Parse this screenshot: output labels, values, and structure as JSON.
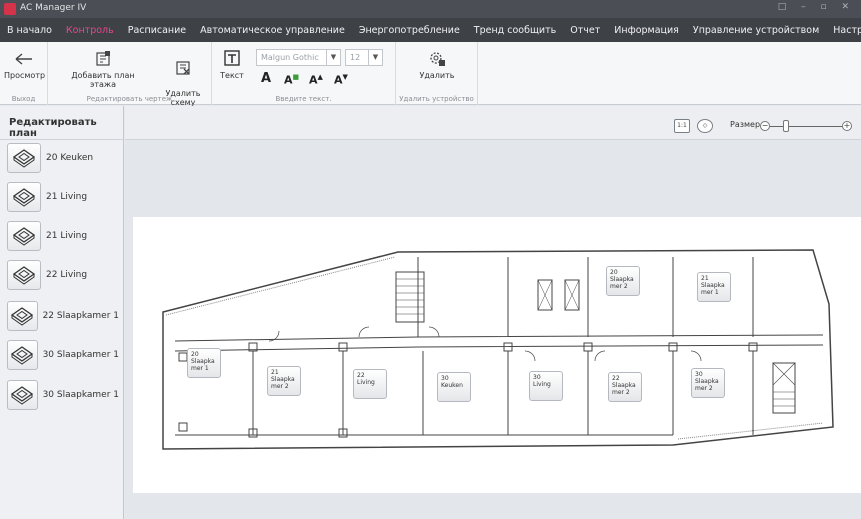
{
  "window": {
    "title": "AC Manager IV",
    "controls": "□ – ▫ ✕"
  },
  "menu": {
    "items": [
      {
        "label": "В начало",
        "active": false
      },
      {
        "label": "Контроль",
        "active": true
      },
      {
        "label": "Расписание",
        "active": false
      },
      {
        "label": "Автоматическое управление",
        "active": false
      },
      {
        "label": "Энергопотребление",
        "active": false
      },
      {
        "label": "Тренд сообщить",
        "active": false
      },
      {
        "label": "Отчет",
        "active": false
      },
      {
        "label": "Информация",
        "active": false
      },
      {
        "label": "Управление устройством",
        "active": false
      },
      {
        "label": "Настройки",
        "active": false
      }
    ]
  },
  "ribbon": {
    "exit_group": {
      "label": "Выход",
      "view_button": "Просмотр"
    },
    "edit_group": {
      "label": "Редактировать чертеж",
      "add_floor_button": "Добавить план этажа",
      "delete_plan_button": "Удалить\nсхему"
    },
    "text_group": {
      "label": "Введите текст.",
      "text_button": "Текст",
      "font_value": "Malgun Gothic",
      "size_value": "12"
    },
    "device_group": {
      "label": "Удалить устройство",
      "delete_button": "Удалить"
    }
  },
  "sidebar": {
    "title": "Редактировать план",
    "units": [
      {
        "label": "20 Keuken"
      },
      {
        "label": "21 Living"
      },
      {
        "label": "21 Living"
      },
      {
        "label": "22 Living"
      },
      {
        "label": "22 Slaapkamer 1"
      },
      {
        "label": "30 Slaapkamer 1"
      },
      {
        "label": "30 Slaapkamer 1"
      }
    ]
  },
  "canvas": {
    "size_label": "Размер",
    "zoom_level": 0.2,
    "fit_icon_text": "1:1"
  },
  "floor_plan": {
    "rooms": [
      {
        "text": "20\nSlaapka\nmer 2"
      },
      {
        "text": "21\nSlaapka\nmer 1"
      },
      {
        "text": "20\nSlaapka\nmer 1"
      },
      {
        "text": "21\nSlaapka\nmer 2"
      },
      {
        "text": "22\nLiving"
      },
      {
        "text": "30\nKeuken"
      },
      {
        "text": "30\nLiving"
      },
      {
        "text": "22\nSlaapka\nmer 2"
      },
      {
        "text": "30\nSlaapka\nmer 2"
      }
    ]
  },
  "colors": {
    "menubar": "#3e4146",
    "active_menu": "#e8468f",
    "titlebar": "#4b4e54"
  },
  "icons": [
    "app-logo-icon",
    "back-arrow-icon",
    "add-floor-icon",
    "delete-plan-icon",
    "text-icon",
    "delete-device-icon",
    "cassette-unit-icon",
    "fit-icon",
    "center-icon"
  ]
}
